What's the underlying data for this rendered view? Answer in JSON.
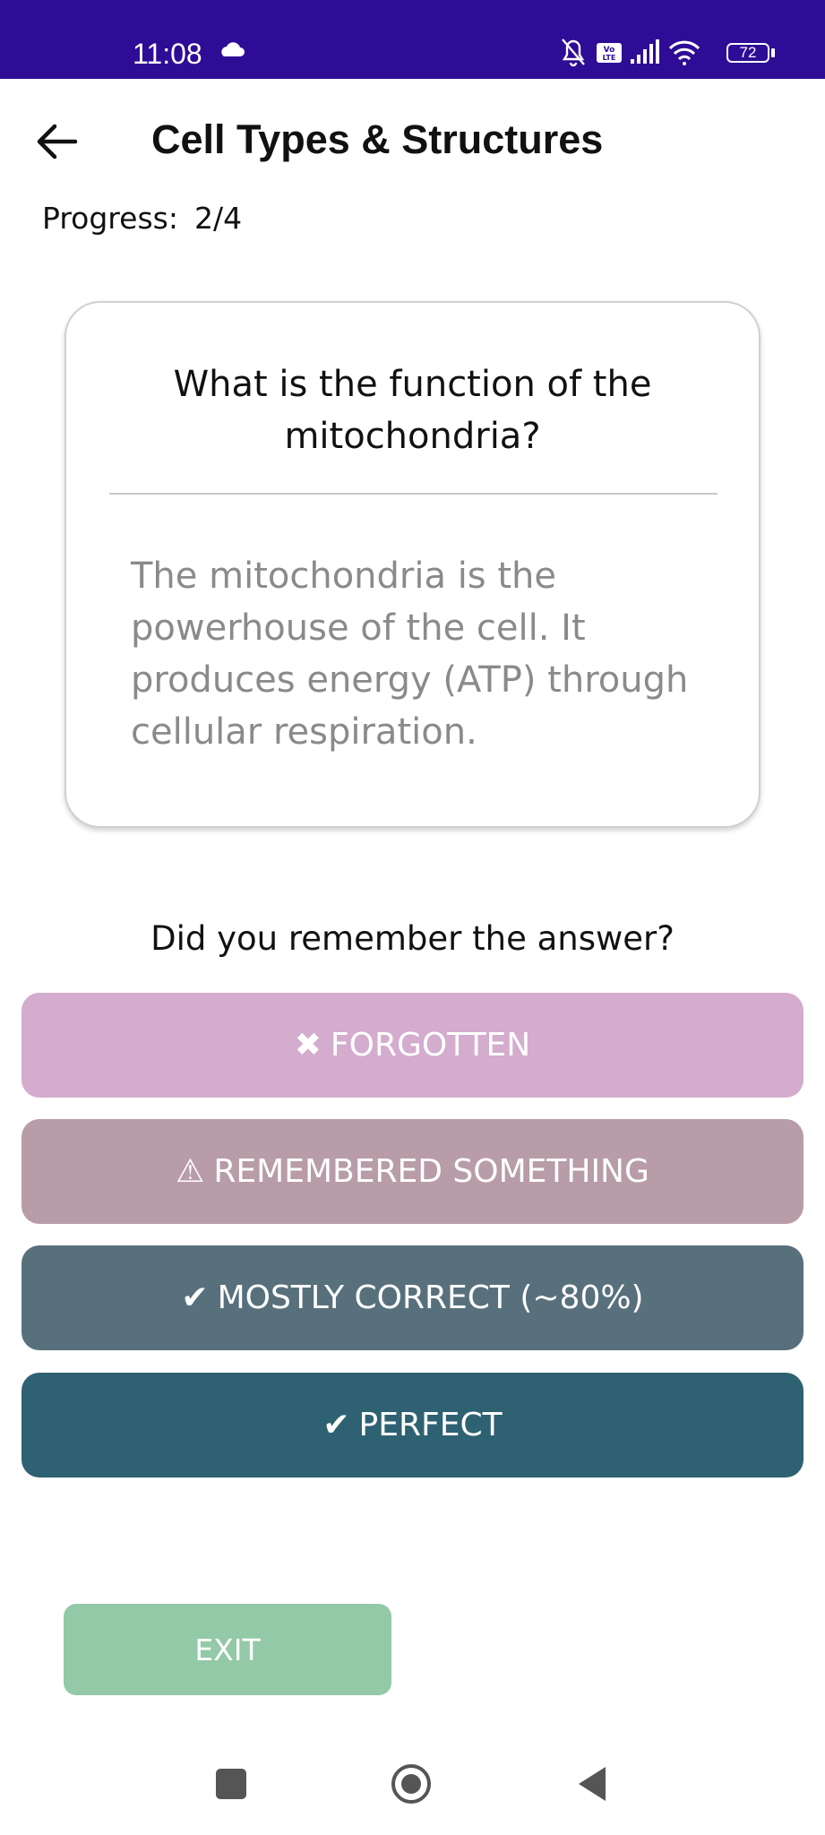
{
  "status_bar": {
    "time": "11:08",
    "battery": "72",
    "icons": [
      "cloud-icon",
      "bell-off-icon",
      "volte-icon",
      "signal-icon",
      "wifi-icon",
      "battery-icon"
    ]
  },
  "header": {
    "title": "Cell Types & Structures",
    "back_icon": "arrow-left-icon"
  },
  "progress": {
    "label": "Progress:",
    "value": "2/4"
  },
  "card": {
    "question": "What is the function of the mitochondria?",
    "answer": "The mitochondria is the powerhouse of the cell. It produces energy (ATP) through cellular respiration."
  },
  "rating": {
    "prompt": "Did you remember the answer?",
    "buttons": [
      {
        "icon": "✖",
        "label": "FORGOTTEN",
        "color": "#d3acce"
      },
      {
        "icon": "⚠",
        "label": "REMEMBERED SOMETHING",
        "color": "#b89ca8"
      },
      {
        "icon": "✔",
        "label": "MOSTLY CORRECT (~80%)",
        "color": "#58707c"
      },
      {
        "icon": "✔",
        "label": "PERFECT",
        "color": "#2e6272"
      }
    ]
  },
  "exit": {
    "label": "EXIT",
    "color": "#93c9a7"
  },
  "colors": {
    "status_bar": "#2e0c96",
    "answer_text": "#8a8a8a"
  }
}
